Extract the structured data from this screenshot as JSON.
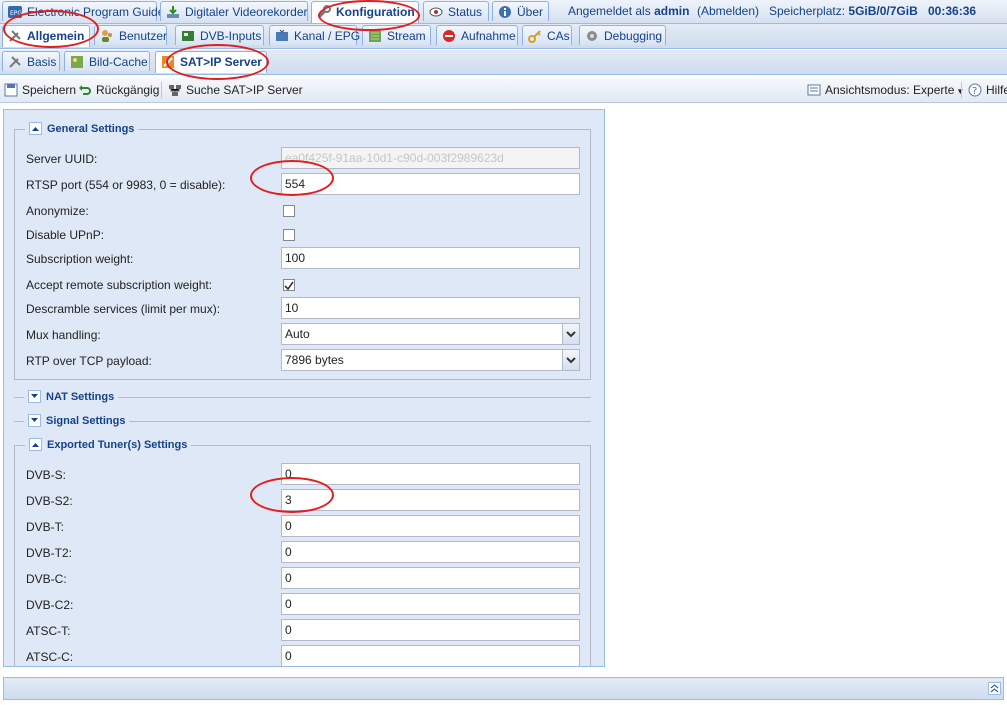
{
  "top_tabs": [
    {
      "label": "Electronic Program Guide",
      "icon": "epg-icon"
    },
    {
      "label": "Digitaler Videorekorder",
      "icon": "download-icon"
    },
    {
      "label": "Konfiguration",
      "icon": "wrench-icon",
      "active": true
    },
    {
      "label": "Status",
      "icon": "eye-icon"
    },
    {
      "label": "Über",
      "icon": "info-icon"
    }
  ],
  "session": {
    "logged_in_prefix": "Angemeldet als",
    "user": "admin",
    "logout": "(Abmelden)",
    "storage_label": "Speicherplatz:",
    "storage_value": "5GiB/0/7GiB",
    "clock": "00:36:36"
  },
  "second_tabs": [
    {
      "label": "Allgemein",
      "icon": "tools-icon",
      "active": true
    },
    {
      "label": "Benutzer",
      "icon": "users-icon"
    },
    {
      "label": "DVB-Inputs",
      "icon": "card-icon"
    },
    {
      "label": "Kanal / EPG",
      "icon": "tv-icon"
    },
    {
      "label": "Stream",
      "icon": "stream-icon"
    },
    {
      "label": "Aufnahme",
      "icon": "record-icon"
    },
    {
      "label": "CAs",
      "icon": "key-icon"
    },
    {
      "label": "Debugging",
      "icon": "debug-icon"
    }
  ],
  "third_tabs": [
    {
      "label": "Basis",
      "icon": "tools-icon"
    },
    {
      "label": "Bild-Cache",
      "icon": "image-icon"
    },
    {
      "label": "SAT>IP Server",
      "icon": "satip-icon",
      "active": true
    }
  ],
  "toolbar": {
    "save": "Speichern",
    "undo": "Rückgängig",
    "search": "Suche SAT>IP Server",
    "view_mode": "Ansichtsmodus: Experte",
    "help": "Hilfe"
  },
  "sections": {
    "general": "General Settings",
    "nat": "NAT Settings",
    "signal": "Signal Settings",
    "tuners": "Exported Tuner(s) Settings"
  },
  "general_fields": {
    "server_uuid": {
      "label": "Server UUID:",
      "value": "ea0f425f-91aa-10d1-c90d-003f2989623d"
    },
    "rtsp_port": {
      "label": "RTSP port (554 or 9983, 0 = disable):",
      "value": "554"
    },
    "anonymize": {
      "label": "Anonymize:",
      "checked": false
    },
    "disable_upnp": {
      "label": "Disable UPnP:",
      "checked": false
    },
    "subscription_weight": {
      "label": "Subscription weight:",
      "value": "100"
    },
    "accept_remote": {
      "label": "Accept remote subscription weight:",
      "checked": true
    },
    "descramble": {
      "label": "Descramble services (limit per mux):",
      "value": "10"
    },
    "mux_handling": {
      "label": "Mux handling:",
      "value": "Auto"
    },
    "rtp_payload": {
      "label": "RTP over TCP payload:",
      "value": "7896 bytes"
    }
  },
  "tuners": [
    {
      "label": "DVB-S:",
      "value": "0"
    },
    {
      "label": "DVB-S2:",
      "value": "3"
    },
    {
      "label": "DVB-T:",
      "value": "0"
    },
    {
      "label": "DVB-T2:",
      "value": "0"
    },
    {
      "label": "DVB-C:",
      "value": "0"
    },
    {
      "label": "DVB-C2:",
      "value": "0"
    },
    {
      "label": "ATSC-T:",
      "value": "0"
    },
    {
      "label": "ATSC-C:",
      "value": "0"
    }
  ],
  "colors": {
    "accent": "#15428b",
    "annotation_ring": "#e31d1d",
    "panel_bg": "#dfe8f6"
  }
}
